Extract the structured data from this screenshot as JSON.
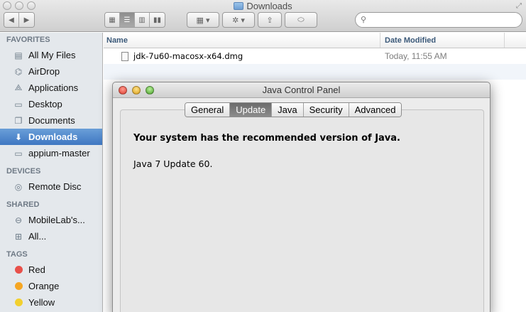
{
  "finder": {
    "title": "Downloads",
    "search": {
      "value": "",
      "placeholder": ""
    },
    "columns": {
      "name": "Name",
      "date": "Date Modified"
    },
    "files": [
      {
        "name": "jdk-7u60-macosx-x64.dmg",
        "date": "Today, 11:55 AM"
      }
    ],
    "sidebar": {
      "favorites": {
        "heading": "FAVORITES",
        "items": [
          {
            "label": "All My Files",
            "icon": "all-files-icon"
          },
          {
            "label": "AirDrop",
            "icon": "airdrop-icon"
          },
          {
            "label": "Applications",
            "icon": "applications-icon"
          },
          {
            "label": "Desktop",
            "icon": "desktop-icon"
          },
          {
            "label": "Documents",
            "icon": "documents-icon"
          },
          {
            "label": "Downloads",
            "icon": "downloads-icon"
          },
          {
            "label": "appium-master",
            "icon": "folder-icon"
          }
        ]
      },
      "devices": {
        "heading": "DEVICES",
        "items": [
          {
            "label": "Remote Disc",
            "icon": "disc-icon"
          }
        ]
      },
      "shared": {
        "heading": "SHARED",
        "items": [
          {
            "label": "MobileLab's...",
            "icon": "network-server-icon"
          },
          {
            "label": "All...",
            "icon": "network-icon"
          }
        ]
      },
      "tags": {
        "heading": "TAGS",
        "items": [
          {
            "label": "Red",
            "color": "#e8504a"
          },
          {
            "label": "Orange",
            "color": "#f5a623"
          },
          {
            "label": "Yellow",
            "color": "#f2d02e"
          }
        ]
      }
    }
  },
  "java_panel": {
    "title": "Java Control Panel",
    "tabs": [
      "General",
      "Update",
      "Java",
      "Security",
      "Advanced"
    ],
    "active_tab": "Update",
    "message": "Your system has the recommended version of Java.",
    "version": "Java 7 Update 60."
  }
}
